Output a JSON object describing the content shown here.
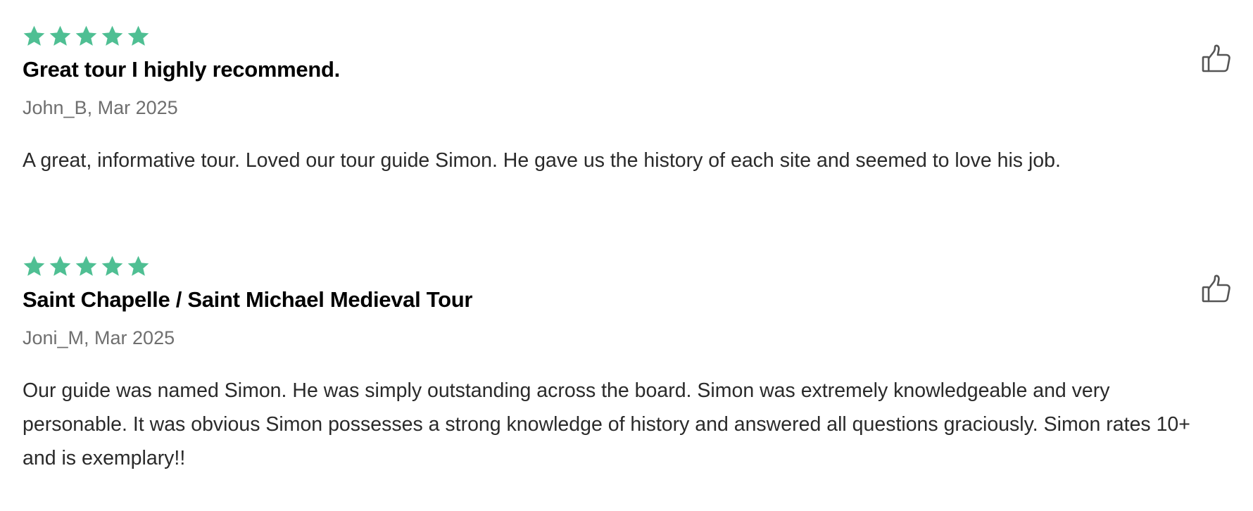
{
  "colors": {
    "star": "#4fbf93",
    "title": "#000000",
    "meta": "#6f6f6f",
    "body": "#2a2a2a",
    "thumb_icon": "#555555"
  },
  "reviews": [
    {
      "rating": 5,
      "title": "Great tour I highly recommend.",
      "meta": "John_B, Mar 2025",
      "body": "A great, informative tour. Loved our tour guide Simon. He gave us the history of each site and seemed to love his job.",
      "helpful_icon": "thumbs-up-icon"
    },
    {
      "rating": 5,
      "title": "Saint Chapelle / Saint Michael Medieval Tour",
      "meta": "Joni_M, Mar 2025",
      "body": "Our guide was named Simon. He was simply outstanding across the board. Simon was extremely knowledgeable and very personable. It was obvious Simon possesses a strong knowledge of history and answered all questions graciously. Simon rates 10+ and is exemplary!!",
      "helpful_icon": "thumbs-up-icon"
    }
  ]
}
